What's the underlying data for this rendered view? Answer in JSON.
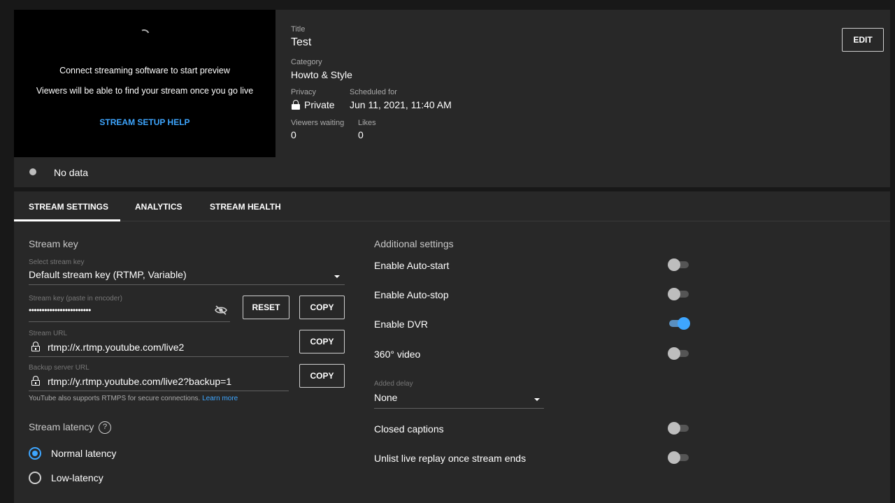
{
  "preview": {
    "line1": "Connect streaming software to start preview",
    "line2": "Viewers will be able to find your stream once you go live",
    "setup_help": "STREAM SETUP HELP"
  },
  "details": {
    "title_label": "Title",
    "title": "Test",
    "category_label": "Category",
    "category": "Howto & Style",
    "privacy_label": "Privacy",
    "privacy": "Private",
    "scheduled_label": "Scheduled for",
    "scheduled": "Jun 11, 2021, 11:40 AM",
    "viewers_label": "Viewers waiting",
    "viewers": "0",
    "likes_label": "Likes",
    "likes": "0",
    "edit": "EDIT"
  },
  "status": {
    "text": "No data"
  },
  "tabs": [
    {
      "label": "STREAM SETTINGS",
      "active": true
    },
    {
      "label": "ANALYTICS",
      "active": false
    },
    {
      "label": "STREAM HEALTH",
      "active": false
    }
  ],
  "stream_key": {
    "section": "Stream key",
    "select_label": "Select stream key",
    "select_value": "Default stream key (RTMP, Variable)",
    "key_label": "Stream key (paste in encoder)",
    "key_value": "••••••••••••••••••••••••",
    "reset": "RESET",
    "copy": "COPY",
    "url_label": "Stream URL",
    "url_value": "rtmp://x.rtmp.youtube.com/live2",
    "backup_label": "Backup server URL",
    "backup_value": "rtmp://y.rtmp.youtube.com/live2?backup=1",
    "note": "YouTube also supports RTMPS for secure connections.",
    "learn_more": "Learn more"
  },
  "latency": {
    "section": "Stream latency",
    "help": "?",
    "options": [
      {
        "label": "Normal latency",
        "selected": true
      },
      {
        "label": "Low-latency",
        "selected": false
      }
    ]
  },
  "additional": {
    "section": "Additional settings",
    "auto_start": {
      "label": "Enable Auto-start",
      "on": false
    },
    "auto_stop": {
      "label": "Enable Auto-stop",
      "on": false
    },
    "dvr": {
      "label": "Enable DVR",
      "on": true
    },
    "video360": {
      "label": "360° video",
      "on": false
    },
    "delay_label": "Added delay",
    "delay_value": "None",
    "captions": {
      "label": "Closed captions",
      "on": false
    },
    "unlist": {
      "label": "Unlist live replay once stream ends",
      "on": false
    }
  },
  "colors": {
    "accent": "#3ea6ff",
    "panel": "#282828",
    "background": "#181818"
  }
}
